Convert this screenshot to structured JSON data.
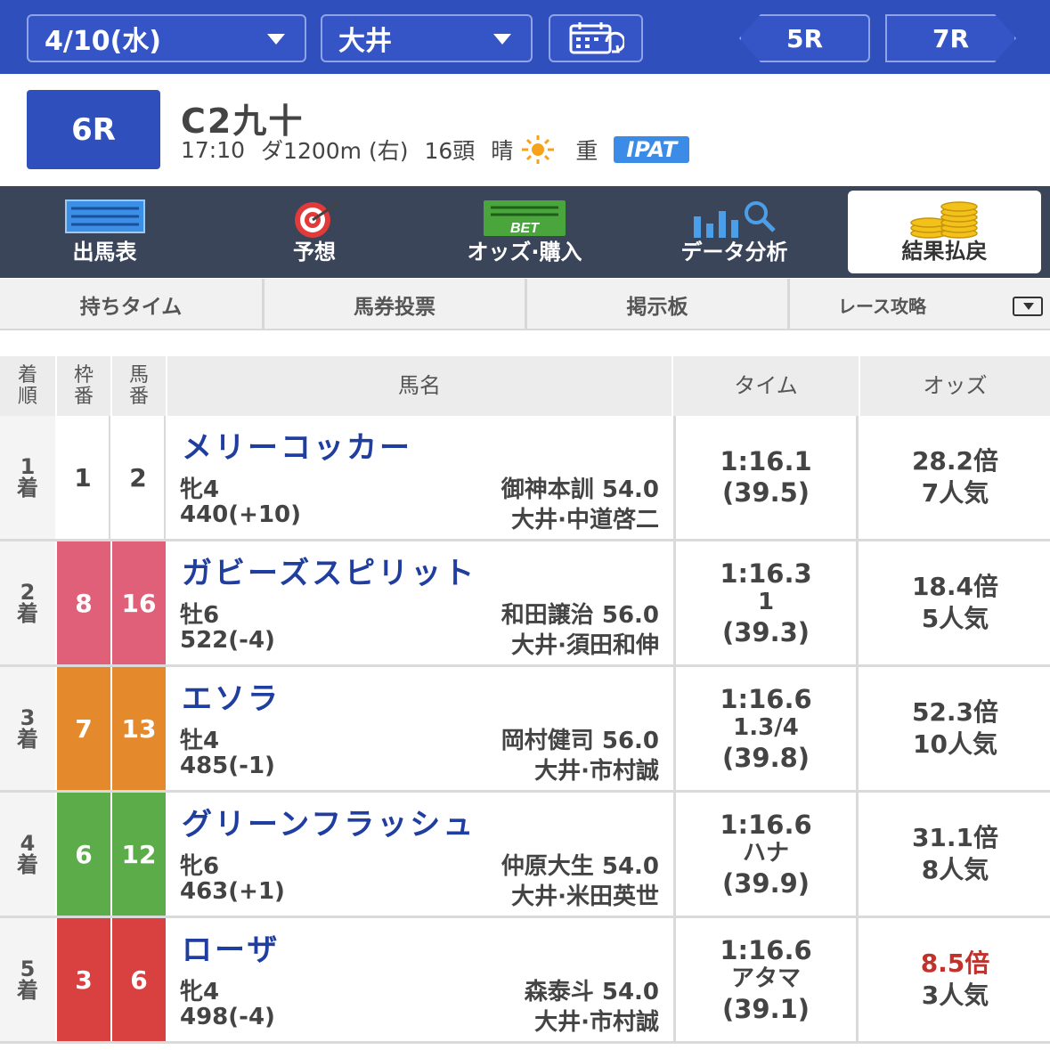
{
  "topbar": {
    "date": "4/10(水)",
    "venue": "大井",
    "prev_race": "5R",
    "next_race": "7R"
  },
  "race": {
    "number": "6R",
    "name": "C2九十",
    "time": "17:10",
    "course": "ダ1200m (右)",
    "runners": "16頭",
    "weather": "晴",
    "track": "重",
    "ipat": "IPAT"
  },
  "menu": [
    {
      "label": "出馬表",
      "icon": "race-card-icon"
    },
    {
      "label": "予想",
      "icon": "target-icon"
    },
    {
      "label": "オッズ·購入",
      "icon": "bet-icon"
    },
    {
      "label": "データ分析",
      "icon": "chart-search-icon"
    },
    {
      "label": "結果払戻",
      "icon": "coins-icon"
    }
  ],
  "subtabs": [
    "持ちタイム",
    "馬券投票",
    "掲示板",
    "レース攻略"
  ],
  "table": {
    "headers": {
      "rank": "着順",
      "waku": "枠番",
      "uma": "馬番",
      "name": "馬名",
      "time": "タイム",
      "odds": "オッズ"
    },
    "rows": [
      {
        "rank": "1着",
        "waku": "1",
        "uma": "2",
        "waku_color": "#ffffff",
        "waku_text": "#444444",
        "name": "メリーコッカー",
        "sexage": "牝4",
        "jockey": "御神本訓 54.0",
        "weight": "440(+10)",
        "trainer": "大井·中道啓二",
        "time": "1:16.1",
        "margin": "",
        "last3f": "(39.5)",
        "odds": "28.2倍",
        "pop": "7人気"
      },
      {
        "rank": "2着",
        "waku": "8",
        "uma": "16",
        "waku_color": "#e0607a",
        "waku_text": "#ffffff",
        "name": "ガビーズスピリット",
        "sexage": "牡6",
        "jockey": "和田譲治 56.0",
        "weight": "522(-4)",
        "trainer": "大井·須田和伸",
        "time": "1:16.3",
        "margin": "1",
        "last3f": "(39.3)",
        "odds": "18.4倍",
        "pop": "5人気"
      },
      {
        "rank": "3着",
        "waku": "7",
        "uma": "13",
        "waku_color": "#e48a2c",
        "waku_text": "#ffffff",
        "name": "エソラ",
        "sexage": "牡4",
        "jockey": "岡村健司 56.0",
        "weight": "485(-1)",
        "trainer": "大井·市村誠",
        "time": "1:16.6",
        "margin": "1.3/4",
        "last3f": "(39.8)",
        "odds": "52.3倍",
        "pop": "10人気"
      },
      {
        "rank": "4着",
        "waku": "6",
        "uma": "12",
        "waku_color": "#5cad4a",
        "waku_text": "#ffffff",
        "name": "グリーンフラッシュ",
        "sexage": "牝6",
        "jockey": "仲原大生 54.0",
        "weight": "463(+1)",
        "trainer": "大井·米田英世",
        "time": "1:16.6",
        "margin": "ハナ",
        "last3f": "(39.9)",
        "odds": "31.1倍",
        "pop": "8人気"
      },
      {
        "rank": "5着",
        "waku": "3",
        "uma": "6",
        "waku_color": "#d94040",
        "waku_text": "#ffffff",
        "name": "ローザ",
        "sexage": "牝4",
        "jockey": "森泰斗 54.0",
        "weight": "498(-4)",
        "trainer": "大井·市村誠",
        "time": "1:16.6",
        "margin": "アタマ",
        "last3f": "(39.1)",
        "odds": "8.5倍",
        "pop": "3人気",
        "odds_hot": true
      }
    ]
  }
}
